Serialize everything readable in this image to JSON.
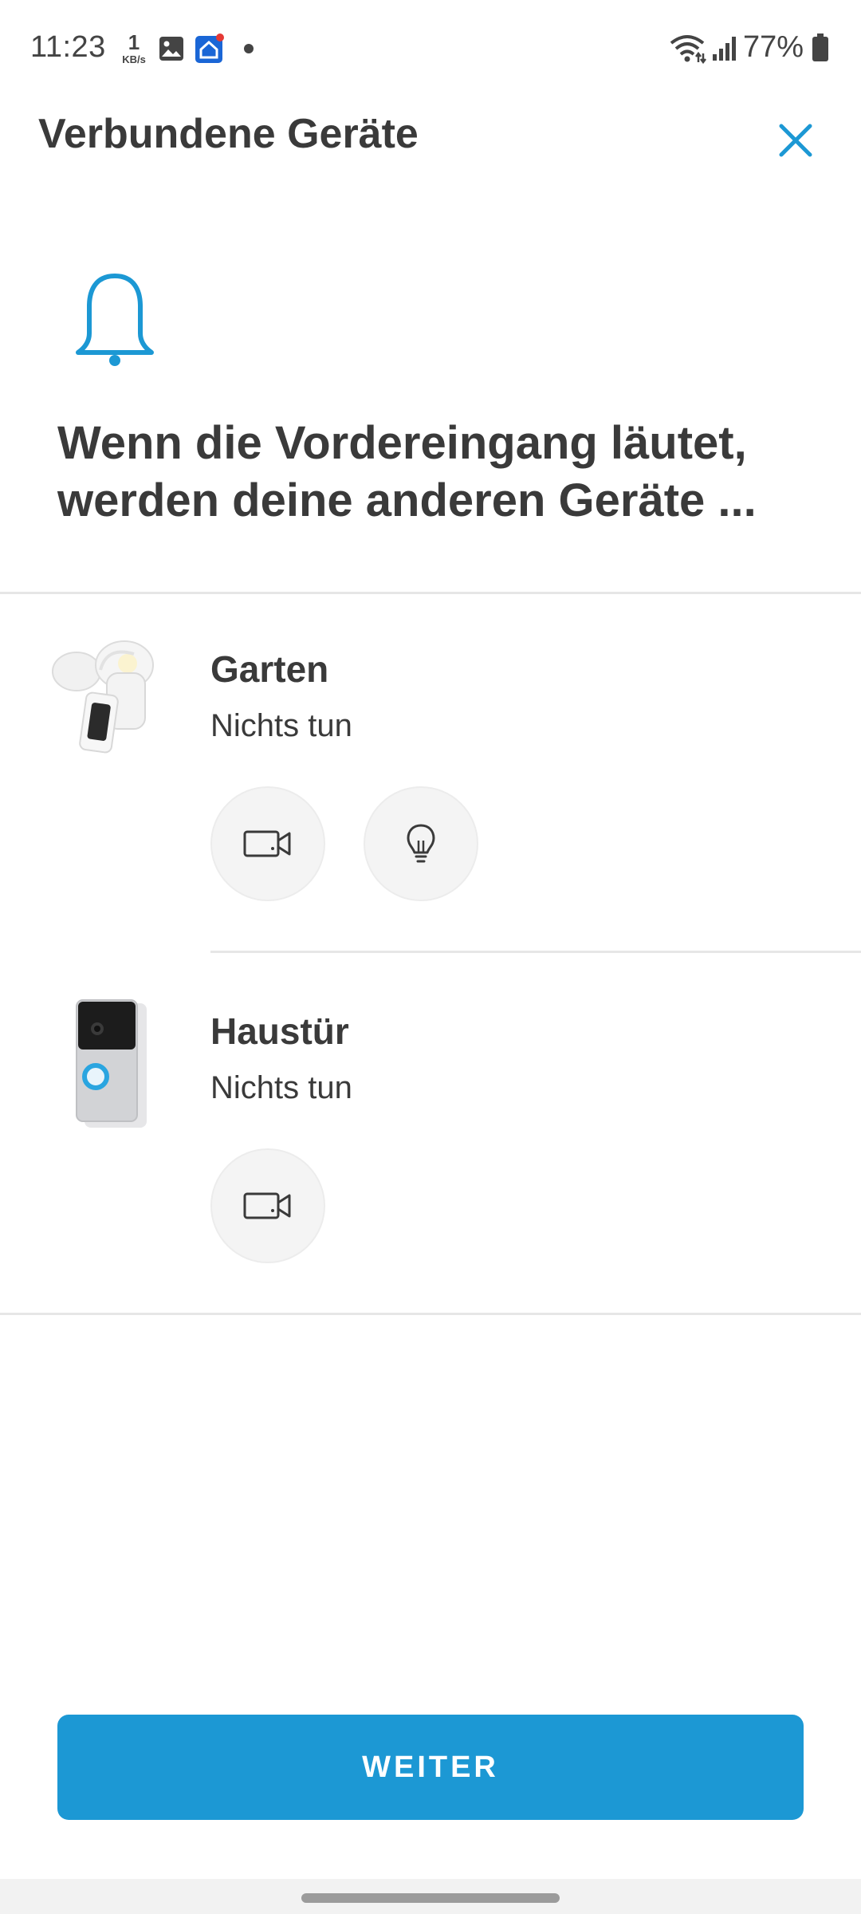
{
  "status_bar": {
    "time": "11:23",
    "net_speed_value": "1",
    "net_speed_unit": "KB/s",
    "battery_text": "77%",
    "icons": [
      "gallery-icon",
      "home-app-icon",
      "notification-dot",
      "wifi-icon",
      "signal-icon",
      "battery-icon"
    ]
  },
  "header": {
    "title": "Verbundene Geräte",
    "close_icon": "close-icon"
  },
  "intro": {
    "icon": "bell-icon",
    "text": "Wenn die Vordereingang läutet, werden deine anderen Geräte ..."
  },
  "devices": [
    {
      "name": "Garten",
      "status": "Nichts tun",
      "image": "floodlight-camera-image",
      "actions": [
        "video-camera-icon",
        "light-bulb-icon"
      ]
    },
    {
      "name": "Haustür",
      "status": "Nichts tun",
      "image": "video-doorbell-image",
      "actions": [
        "video-camera-icon"
      ]
    }
  ],
  "footer": {
    "primary_button": "WEITER"
  },
  "colors": {
    "accent": "#1c98d4",
    "text": "#3a3a3a",
    "divider": "#e6e6e6",
    "action_bg": "#f4f4f4"
  }
}
